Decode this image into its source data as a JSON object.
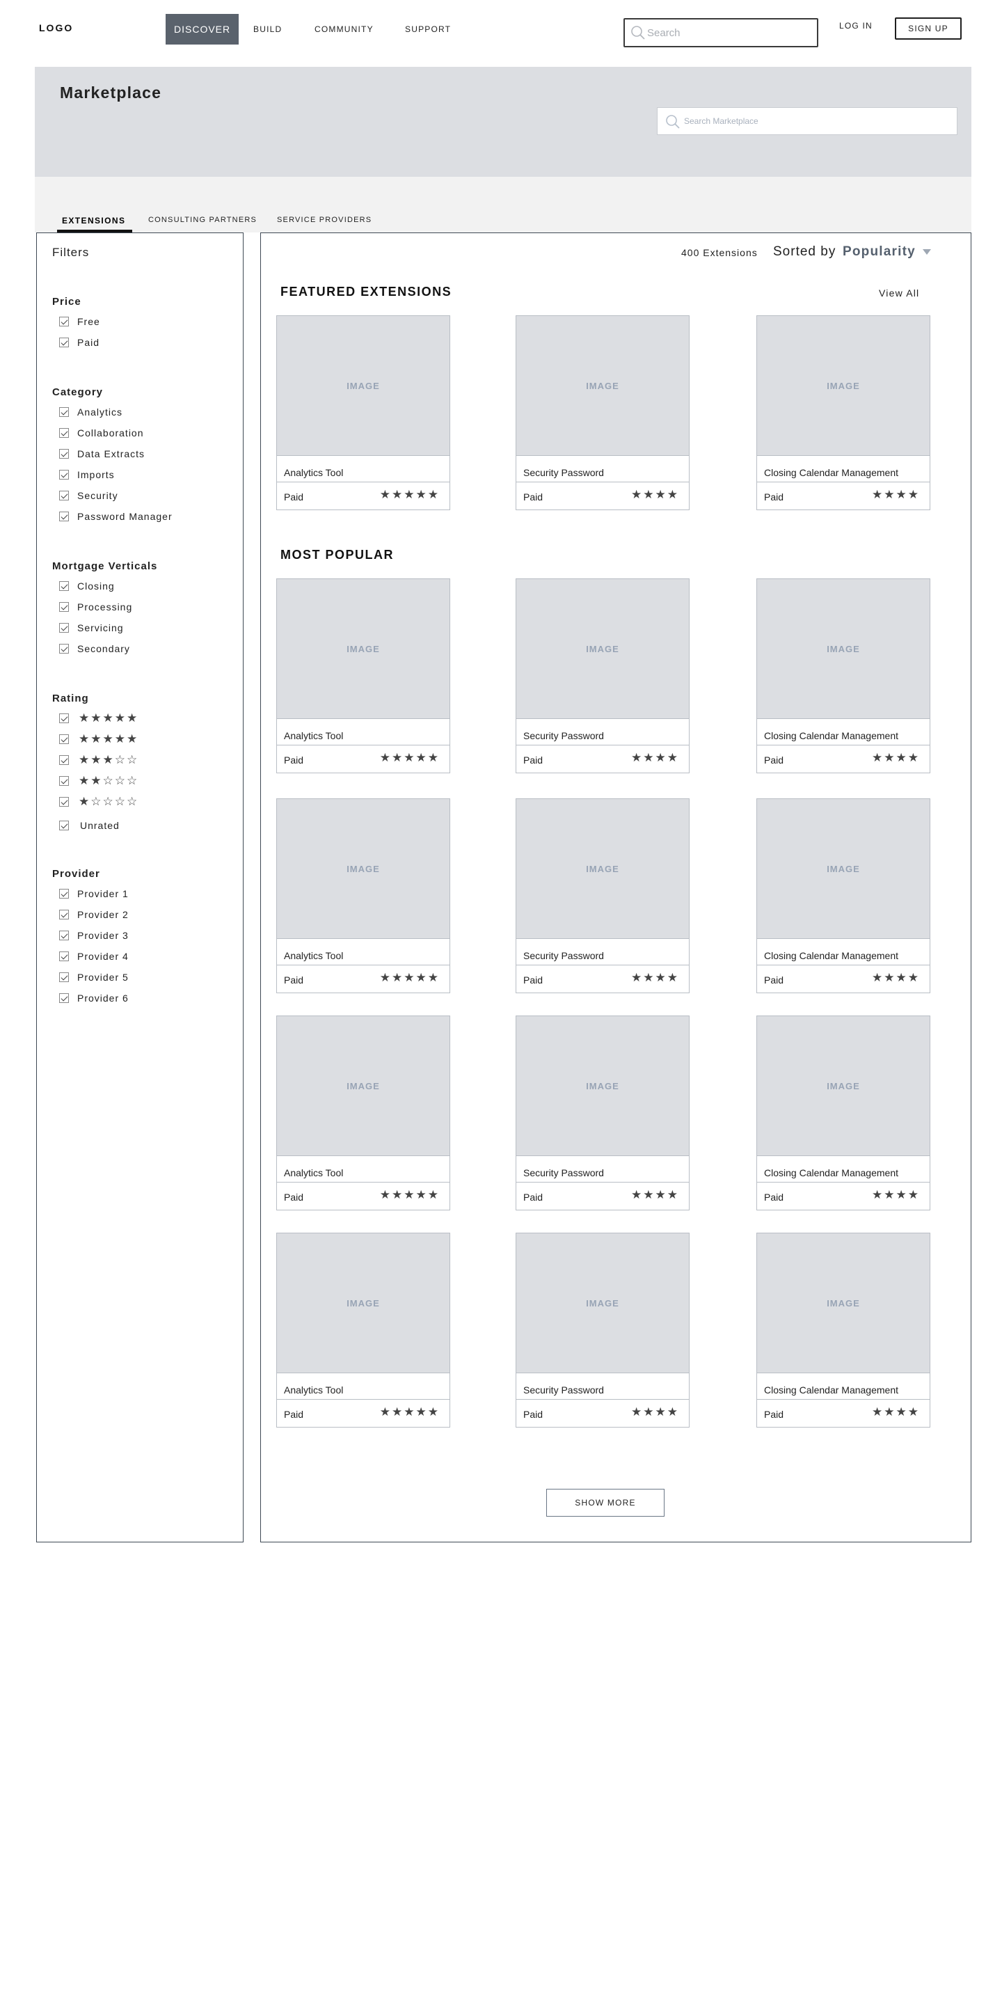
{
  "nav": {
    "logo": "LOGO",
    "links": [
      {
        "label": "DISCOVER",
        "active": true
      },
      {
        "label": "BUILD"
      },
      {
        "label": "COMMUNITY"
      },
      {
        "label": "SUPPORT"
      }
    ],
    "search_placeholder": "Search",
    "login_label": "LOG IN",
    "signup_label": "SIGN UP"
  },
  "banner": {
    "title": "Marketplace",
    "search_placeholder": "Search Marketplace"
  },
  "tabs": [
    {
      "label": "EXTENSIONS",
      "active": true
    },
    {
      "label": "CONSULTING PARTNERS"
    },
    {
      "label": "SERVICE PROVIDERS"
    }
  ],
  "filters": {
    "title": "Filters",
    "price": {
      "title": "Price",
      "options": [
        "Free",
        "Paid"
      ]
    },
    "category": {
      "title": "Category",
      "options": [
        "Analytics",
        "Collaboration",
        "Data Extracts",
        "Imports",
        "Security",
        "Password Manager"
      ]
    },
    "verticals": {
      "title": "Mortgage Verticals",
      "options": [
        "Closing",
        "Processing",
        "Servicing",
        "Secondary"
      ]
    },
    "rating": {
      "title": "Rating",
      "options": [
        {
          "stars": "★★★★★"
        },
        {
          "stars": "★★★★★"
        },
        {
          "stars": "★★★☆☆"
        },
        {
          "stars": "★★☆☆☆"
        },
        {
          "stars": "★☆☆☆☆"
        }
      ],
      "unrated": "Unrated"
    },
    "provider": {
      "title": "Provider",
      "options": [
        "Provider 1",
        "Provider 2",
        "Provider 3",
        "Provider 4",
        "Provider 5",
        "Provider 6"
      ]
    }
  },
  "results": {
    "count": "400 Extensions",
    "sorted_label": "Sorted by",
    "sort_value": "Popularity",
    "featured_title": "FEATURED EXTENSIONS",
    "view_all": "View All",
    "popular_title": "MOST POPULAR",
    "image_placeholder": "IMAGE",
    "featured": [
      {
        "name": "Analytics Tool",
        "price": "Paid",
        "stars": "★★★★★"
      },
      {
        "name": "Security Password",
        "price": "Paid",
        "stars": "★★★★"
      },
      {
        "name": "Closing Calendar Management",
        "price": "Paid",
        "stars": "★★★★"
      }
    ],
    "popular": [
      {
        "name": "Analytics Tool",
        "price": "Paid",
        "stars": "★★★★★"
      },
      {
        "name": "Security Password",
        "price": "Paid",
        "stars": "★★★★"
      },
      {
        "name": "Closing Calendar Management",
        "price": "Paid",
        "stars": "★★★★"
      },
      {
        "name": "Analytics Tool",
        "price": "Paid",
        "stars": "★★★★★"
      },
      {
        "name": "Security Password",
        "price": "Paid",
        "stars": "★★★★"
      },
      {
        "name": "Closing Calendar Management",
        "price": "Paid",
        "stars": "★★★★"
      },
      {
        "name": "Analytics Tool",
        "price": "Paid",
        "stars": "★★★★★"
      },
      {
        "name": "Security Password",
        "price": "Paid",
        "stars": "★★★★"
      },
      {
        "name": "Closing Calendar Management",
        "price": "Paid",
        "stars": "★★★★"
      },
      {
        "name": "Analytics Tool",
        "price": "Paid",
        "stars": "★★★★★"
      },
      {
        "name": "Security Password",
        "price": "Paid",
        "stars": "★★★★"
      },
      {
        "name": "Closing Calendar Management",
        "price": "Paid",
        "stars": "★★★★"
      }
    ],
    "show_more": "SHOW MORE"
  }
}
